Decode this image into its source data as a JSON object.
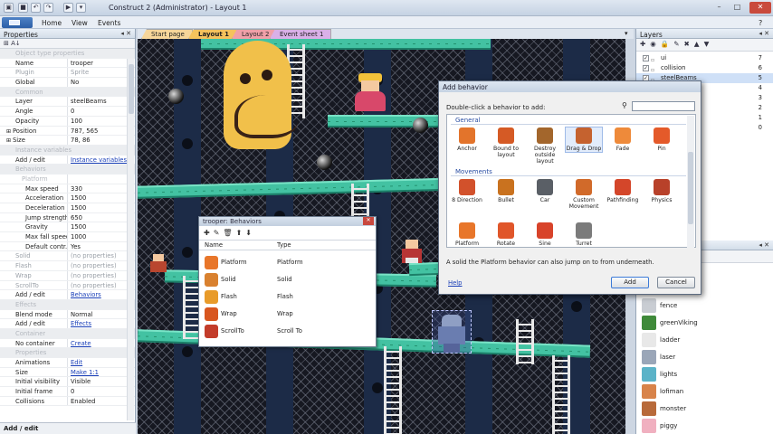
{
  "window": {
    "title": "Construct 2 (Administrator) - Layout 1"
  },
  "menu": {
    "items": [
      "Home",
      "View",
      "Events"
    ]
  },
  "properties": {
    "title": "Properties",
    "rows": [
      {
        "k": "Object type properties",
        "v": "",
        "t": "sec"
      },
      {
        "k": "Name",
        "v": "trooper"
      },
      {
        "k": "Plugin",
        "v": "Sprite",
        "t": "dis"
      },
      {
        "k": "Global",
        "v": "No"
      },
      {
        "k": "Common",
        "v": "",
        "t": "sec"
      },
      {
        "k": "Layer",
        "v": "steelBeams"
      },
      {
        "k": "Angle",
        "v": "0"
      },
      {
        "k": "Opacity",
        "v": "100"
      },
      {
        "k": "Position",
        "v": "787, 565",
        "t": "exp"
      },
      {
        "k": "Size",
        "v": "78, 86",
        "t": "exp"
      },
      {
        "k": "Instance variables",
        "v": "",
        "t": "sec"
      },
      {
        "k": "Add / edit",
        "v": "Instance variables",
        "t": "lnk"
      },
      {
        "k": "Behaviors",
        "v": "",
        "t": "sec"
      },
      {
        "k": "Platform",
        "v": "",
        "t": "sub"
      },
      {
        "k": "Max speed",
        "v": "330",
        "t": "ind"
      },
      {
        "k": "Acceleration",
        "v": "1500",
        "t": "ind"
      },
      {
        "k": "Deceleration",
        "v": "1500",
        "t": "ind"
      },
      {
        "k": "Jump strength",
        "v": "650",
        "t": "ind"
      },
      {
        "k": "Gravity",
        "v": "1500",
        "t": "ind"
      },
      {
        "k": "Max fall speed",
        "v": "1000",
        "t": "ind"
      },
      {
        "k": "Default contr...",
        "v": "Yes",
        "t": "ind"
      },
      {
        "k": "Solid",
        "v": "(no properties)",
        "t": "dis"
      },
      {
        "k": "Flash",
        "v": "(no properties)",
        "t": "dis"
      },
      {
        "k": "Wrap",
        "v": "(no properties)",
        "t": "dis"
      },
      {
        "k": "ScrollTo",
        "v": "(no properties)",
        "t": "dis"
      },
      {
        "k": "Add / edit",
        "v": "Behaviors",
        "t": "lnk"
      },
      {
        "k": "Effects",
        "v": "",
        "t": "sec"
      },
      {
        "k": "Blend mode",
        "v": "Normal"
      },
      {
        "k": "Add / edit",
        "v": "Effects",
        "t": "lnk"
      },
      {
        "k": "Container",
        "v": "",
        "t": "sec"
      },
      {
        "k": "No container",
        "v": "Create",
        "t": "lnk"
      },
      {
        "k": "Properties",
        "v": "",
        "t": "sec"
      },
      {
        "k": "Animations",
        "v": "Edit",
        "t": "lnk"
      },
      {
        "k": "Size",
        "v": "Make 1:1",
        "t": "lnk"
      },
      {
        "k": "Initial visibility",
        "v": "Visible"
      },
      {
        "k": "Initial frame",
        "v": "0"
      },
      {
        "k": "Collisions",
        "v": "Enabled"
      }
    ],
    "footer": "Add / edit"
  },
  "tabs": [
    {
      "label": "Start page",
      "color": "#f7d69a"
    },
    {
      "label": "Layout 1",
      "color": "#f5c25c"
    },
    {
      "label": "Layout 2",
      "color": "#f0a0a8"
    },
    {
      "label": "Event sheet 1",
      "color": "#d9b0e8"
    }
  ],
  "layers": {
    "title": "Layers",
    "rows": [
      {
        "name": "ui",
        "num": "7",
        "checked": true
      },
      {
        "name": "collision",
        "num": "6",
        "checked": true
      },
      {
        "name": "steelBeams",
        "num": "5",
        "checked": true
      },
      {
        "name": "",
        "num": "4",
        "checked": false
      },
      {
        "name": "",
        "num": "3",
        "checked": false
      },
      {
        "name": "",
        "num": "2",
        "checked": false
      },
      {
        "name": "",
        "num": "1",
        "checked": false
      },
      {
        "name": "",
        "num": "0",
        "checked": false
      }
    ]
  },
  "objects": {
    "rows": [
      {
        "name": "fence",
        "icon": "fence-icon"
      },
      {
        "name": "greenViking",
        "icon": "viking-icon"
      },
      {
        "name": "ladder",
        "icon": "ladder-icon"
      },
      {
        "name": "laser",
        "icon": "laser-icon"
      },
      {
        "name": "lights",
        "icon": "lights-icon"
      },
      {
        "name": "lofiman",
        "icon": "lofiman-icon"
      },
      {
        "name": "monster",
        "icon": "monster-icon"
      },
      {
        "name": "piggy",
        "icon": "piggy-icon"
      }
    ]
  },
  "trooper_behaviors": {
    "title": "trooper: Behaviors",
    "col_name": "Name",
    "col_type": "Type",
    "rows": [
      {
        "name": "Platform",
        "type": "Platform",
        "color": "#e8762a"
      },
      {
        "name": "Solid",
        "type": "Solid",
        "color": "#d9812f"
      },
      {
        "name": "Flash",
        "type": "Flash",
        "color": "#e89b2a"
      },
      {
        "name": "Wrap",
        "type": "Wrap",
        "color": "#d8561f"
      },
      {
        "name": "ScrollTo",
        "type": "Scroll To",
        "color": "#c33c2a"
      }
    ]
  },
  "add_behavior": {
    "title": "Add behavior",
    "hint": "Double-click a behavior to add:",
    "general_label": "General",
    "movements_label": "Movements",
    "general": [
      {
        "label": "Anchor",
        "color": "#e3742b"
      },
      {
        "label": "Bound to layout",
        "color": "#d55a25"
      },
      {
        "label": "Destroy outside layout",
        "color": "#a3662c"
      },
      {
        "label": "Drag & Drop",
        "color": "#c5622f"
      },
      {
        "label": "Fade",
        "color": "#ee8a3a"
      },
      {
        "label": "Pin",
        "color": "#e45a2a"
      }
    ],
    "movements": [
      {
        "label": "8 Direction",
        "color": "#d2512b"
      },
      {
        "label": "Bullet",
        "color": "#c9721f"
      },
      {
        "label": "Car",
        "color": "#5a5f66"
      },
      {
        "label": "Custom Movement",
        "color": "#d16a2a"
      },
      {
        "label": "Pathfinding",
        "color": "#d4462a"
      },
      {
        "label": "Physics",
        "color": "#b8412a"
      },
      {
        "label": "Platform",
        "color": "#e8762a"
      },
      {
        "label": "Rotate",
        "color": "#e0562a"
      },
      {
        "label": "Sine",
        "color": "#d8432a"
      },
      {
        "label": "Turret",
        "color": "#7b7b7b"
      }
    ],
    "description": "A solid the Platform behavior can also jump on to from underneath.",
    "help": "Help",
    "add": "Add",
    "cancel": "Cancel"
  }
}
